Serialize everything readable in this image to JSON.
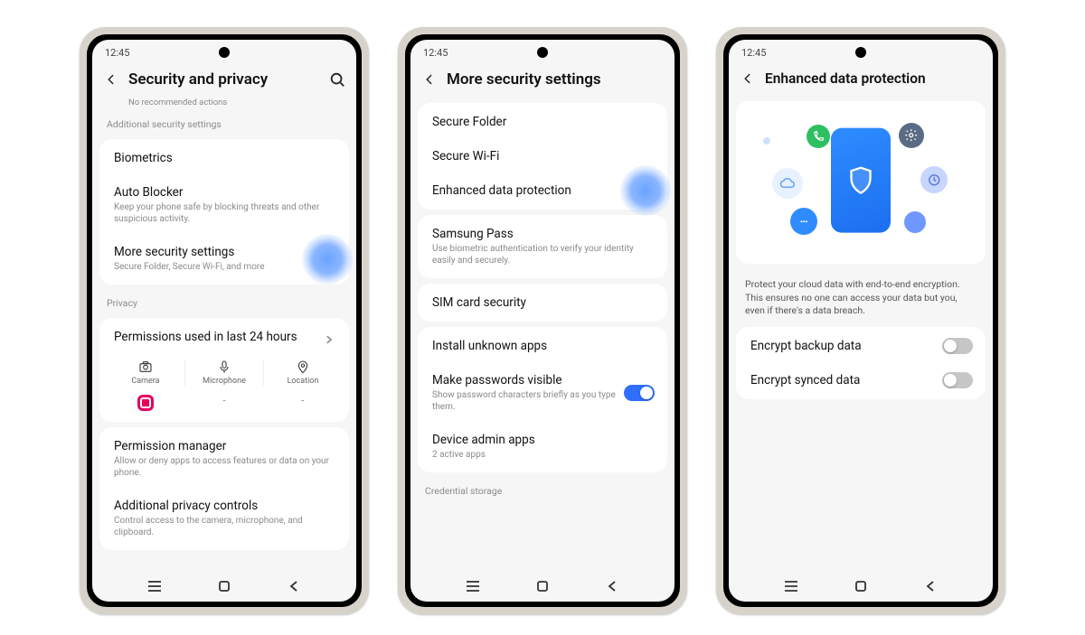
{
  "status_time": "12:45",
  "nav": {
    "recents": "recents",
    "home": "home",
    "back": "back"
  },
  "screen1": {
    "title": "Security and privacy",
    "no_rec": "No recommended actions",
    "sec_additional": "Additional security settings",
    "biometrics": "Biometrics",
    "auto_blocker": "Auto Blocker",
    "auto_blocker_sub": "Keep your phone safe by blocking threats and other suspicious activity.",
    "more_sec": "More security settings",
    "more_sec_sub": "Secure Folder, Secure Wi-Fi, and more",
    "sec_privacy": "Privacy",
    "perm_24h": "Permissions used in last 24 hours",
    "perm_cols": [
      "Camera",
      "Microphone",
      "Location"
    ],
    "perm_apps": [
      "app",
      "-",
      "-"
    ],
    "perm_mgr": "Permission manager",
    "perm_mgr_sub": "Allow or deny apps to access features or data on your phone.",
    "add_priv": "Additional privacy controls",
    "add_priv_sub": "Control access to the camera, microphone, and clipboard."
  },
  "screen2": {
    "title": "More security settings",
    "secure_folder": "Secure Folder",
    "secure_wifi": "Secure Wi-Fi",
    "enhanced": "Enhanced data protection",
    "spass": "Samsung Pass",
    "spass_sub": "Use biometric authentication to verify your identity easily and securely.",
    "sim": "SIM card security",
    "unknown": "Install unknown apps",
    "pwvis": "Make passwords visible",
    "pwvis_sub": "Show password characters briefly as you type them.",
    "devadmin": "Device admin apps",
    "devadmin_sub": "2 active apps",
    "credstore": "Credential storage"
  },
  "screen3": {
    "title": "Enhanced data protection",
    "desc": "Protect your cloud data with end-to-end encryption. This ensures no one can access your data but you, even if there's a data breach.",
    "enc_backup": "Encrypt backup data",
    "enc_synced": "Encrypt synced data"
  }
}
